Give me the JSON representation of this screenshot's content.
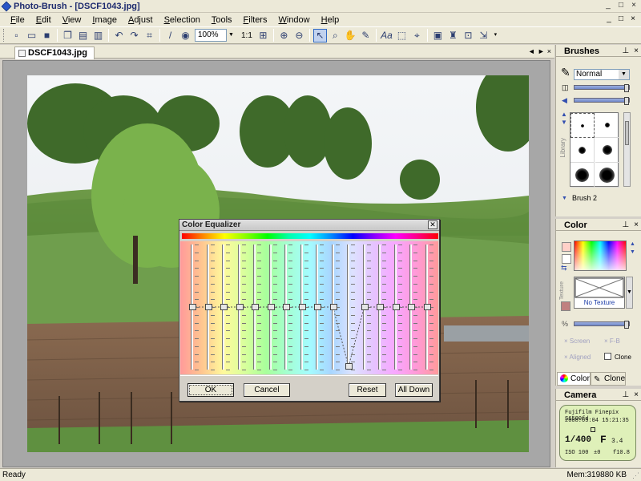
{
  "window": {
    "title": "Photo-Brush - [DSCF1043.jpg]",
    "controls": [
      "_",
      "□",
      "×"
    ]
  },
  "menu": [
    "File",
    "Edit",
    "View",
    "Image",
    "Adjust",
    "Selection",
    "Tools",
    "Filters",
    "Window",
    "Help"
  ],
  "mdi_controls": [
    "_",
    "□",
    "×"
  ],
  "toolbar": {
    "zoom_value": "100%",
    "actual_size_label": "1:1"
  },
  "document": {
    "tab_label": "DSCF1043.jpg",
    "tab_nav": [
      "◄",
      "►",
      "×"
    ]
  },
  "dialog": {
    "title": "Color Equalizer",
    "buttons": {
      "ok": "OK",
      "cancel": "Cancel",
      "reset": "Reset",
      "all_down": "All Down"
    },
    "slider_levels": [
      0.5,
      0.5,
      0.5,
      0.5,
      0.5,
      0.5,
      0.5,
      0.5,
      0.5,
      0.5,
      0.0,
      0.5,
      0.5,
      0.5,
      0.5,
      0.5
    ]
  },
  "brushes_panel": {
    "title": "Brushes",
    "blend_mode": "Normal",
    "library_label": "Library",
    "brush_name": "Brush 2",
    "head_controls": [
      "⊥",
      "×"
    ]
  },
  "color_panel": {
    "title": "Color",
    "texture_label": "Texture",
    "no_texture": "No Texture",
    "screen_label": "Screen",
    "fb_label": "F-B",
    "aligned_label": "Aligned",
    "clone_label": "Clone",
    "tabs": [
      "Color",
      "Clone"
    ],
    "head_controls": [
      "⊥",
      "×"
    ]
  },
  "camera_panel": {
    "title": "Camera",
    "model": "Fujifilm Finepix S6500fd",
    "datetime": "2008:05:04 15:21:35",
    "shutter": "1/400",
    "aperture_label": "F",
    "aperture_value": "3.4",
    "iso": "ISO 100",
    "exposure_bias": "±0",
    "focal": "f10.8",
    "head_controls": [
      "⊥",
      "×"
    ]
  },
  "status": {
    "left": "Ready",
    "memory": "Mem:319880 KB"
  },
  "colors": {
    "accent": "#316ac5",
    "chrome": "#ece9d8",
    "camera_lcd": "#dff0b9"
  }
}
